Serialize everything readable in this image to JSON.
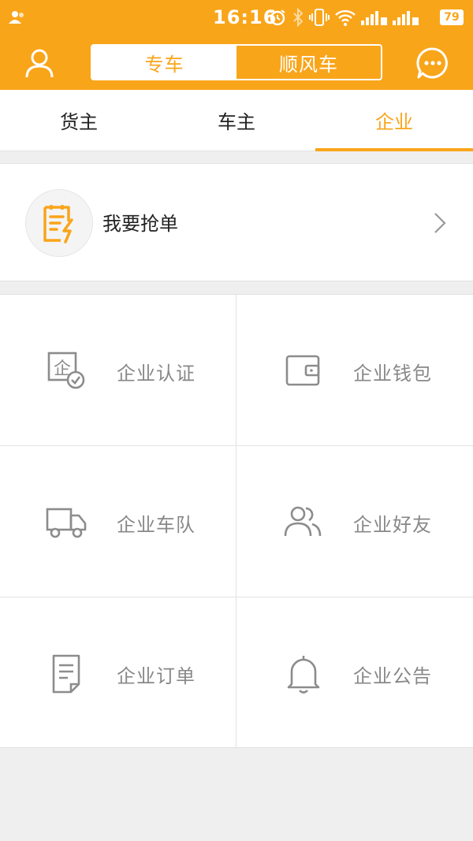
{
  "status_bar": {
    "time": "16:16",
    "battery": "79"
  },
  "header": {
    "segments": [
      "专车",
      "顺风车"
    ],
    "active_segment": 0
  },
  "tabs": [
    "货主",
    "车主",
    "企业"
  ],
  "active_tab": 2,
  "grab_order": {
    "label": "我要抢单"
  },
  "grid": [
    {
      "label": "企业认证",
      "icon": "certificate-icon"
    },
    {
      "label": "企业钱包",
      "icon": "wallet-icon"
    },
    {
      "label": "企业车队",
      "icon": "truck-icon"
    },
    {
      "label": "企业好友",
      "icon": "friends-icon"
    },
    {
      "label": "企业订单",
      "icon": "order-doc-icon"
    },
    {
      "label": "企业公告",
      "icon": "bell-icon"
    }
  ],
  "colors": {
    "accent": "#f9a51a",
    "icon_gray": "#8c8c8c",
    "label_gray": "#888888"
  }
}
